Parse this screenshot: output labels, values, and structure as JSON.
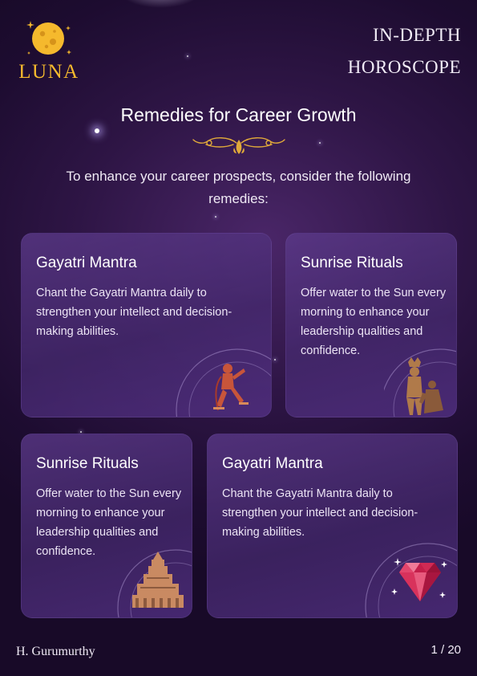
{
  "brand": {
    "name": "LUNA",
    "icon": "moon-icon",
    "accent": "#f5b92d"
  },
  "header": {
    "title_line1": "IN-DEPTH",
    "title_line2": "HOROSCOPE"
  },
  "section": {
    "title": "Remedies for Career Growth",
    "ornament_icon": "gold-flourish-icon",
    "intro": "To enhance your career prospects, consider the following remedies:"
  },
  "cards": [
    {
      "title": "Gayatri Mantra",
      "text": "Chant the Gayatri Mantra daily to strengthen your intellect and decision-making abilities.",
      "art": "hanuman-figure-icon"
    },
    {
      "title": "Sunrise Rituals",
      "text": "Offer water to the Sun every morning to enhance your leadership qualities and confidence.",
      "art": "deity-statue-icon"
    },
    {
      "title": "Sunrise Rituals",
      "text": "Offer water to the Sun every morning to enhance your leadership qualities and confidence.",
      "art": "temple-icon"
    },
    {
      "title": "Gayatri Mantra",
      "text": "Chant the Gayatri Mantra daily to strengthen your intellect and decision-making abilities.",
      "art": "ruby-gem-icon"
    }
  ],
  "footer": {
    "name": "H. Gurumurthy",
    "page": "1 / 20"
  },
  "colors": {
    "background": "#24103a",
    "card": "#5a3a8a",
    "gold": "#f5b92d"
  }
}
